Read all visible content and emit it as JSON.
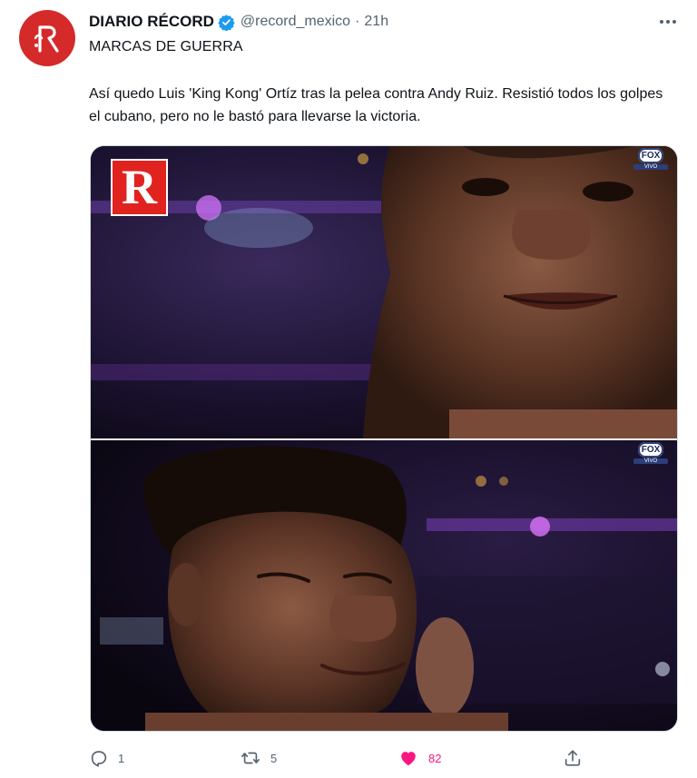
{
  "tweet": {
    "author_name": "DIARIO RÉCORD",
    "handle": "@record_mexico",
    "separator": "·",
    "time": "21h",
    "title": "MARCAS DE GUERRA",
    "body": "Así quedo Luis 'King Kong' Ortíz tras la pelea contra Andy Ruiz. Resistió todos los golpes el cubano, pero no le bastó para llevarse la victoria."
  },
  "media": {
    "logo_letter": "R",
    "broadcaster": "FOX",
    "broadcaster_sub": "VIVO"
  },
  "actions": {
    "replies": "1",
    "retweets": "5",
    "likes": "82"
  },
  "colors": {
    "accent_like": "#f91880",
    "verified_blue": "#1d9bf0",
    "brand_red": "#d42a2a",
    "muted_text": "#536471"
  },
  "icons": {
    "avatar": "record-logo-icon",
    "verified": "verified-badge-icon",
    "more": "more-dots-icon",
    "reply": "reply-icon",
    "retweet": "retweet-icon",
    "like": "heart-icon",
    "share": "share-icon"
  }
}
